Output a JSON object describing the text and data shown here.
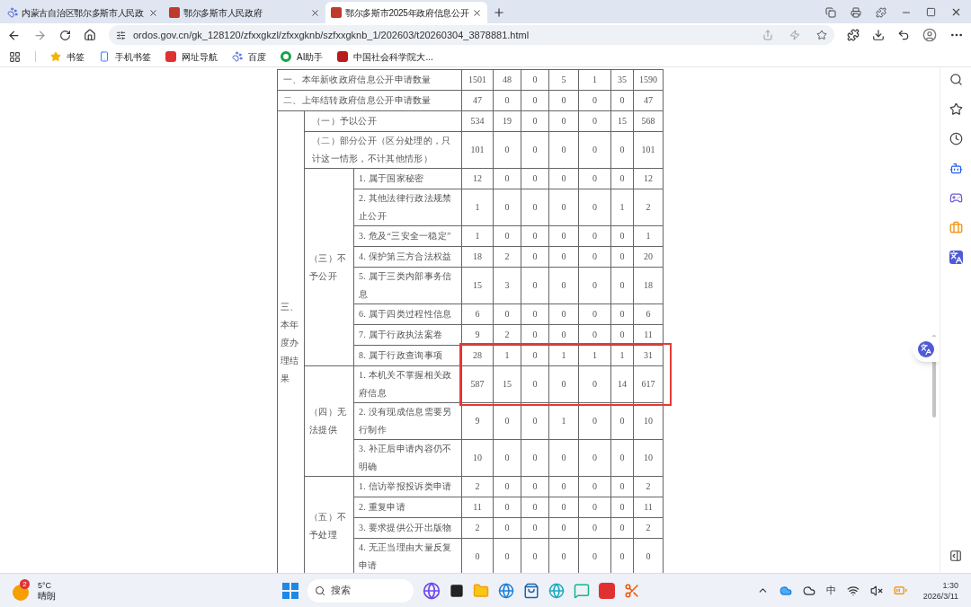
{
  "browser": {
    "tabs": [
      {
        "title": "内蒙古自治区鄂尔多斯市人民政",
        "selected": false
      },
      {
        "title": "鄂尔多斯市人民政府",
        "selected": false
      },
      {
        "title": "鄂尔多斯市2025年政府信息公开",
        "selected": true
      }
    ],
    "address": "ordos.gov.cn/gk_128120/zfxxgkzl/zfxxgknb/szfxxgknb_1/202603/t20260304_3878881.html",
    "bookmarks": [
      "书签",
      "手机书签",
      "网址导航",
      "百度",
      "AI助手",
      "中国社会科学院大..."
    ]
  },
  "table": {
    "top_rows": [
      {
        "label": "一、本年新收政府信息公开申请数量",
        "values": [
          "1501",
          "48",
          "0",
          "5",
          "1",
          "35",
          "1590"
        ]
      },
      {
        "label": "二、上年结转政府信息公开申请数量",
        "values": [
          "47",
          "0",
          "0",
          "0",
          "0",
          "0",
          "47"
        ]
      }
    ],
    "section": {
      "label": "三、本年度办理结果",
      "groups": [
        {
          "label": "（一）予以公开",
          "values": [
            "534",
            "19",
            "0",
            "0",
            "0",
            "15",
            "568"
          ]
        },
        {
          "label": "（二）部分公开（区分处理的，只计这一情形，不计其他情形）",
          "values": [
            "101",
            "0",
            "0",
            "0",
            "0",
            "0",
            "101"
          ]
        },
        {
          "label": "（三）不予公开",
          "items": [
            {
              "label": "1. 属于国家秘密",
              "values": [
                "12",
                "0",
                "0",
                "0",
                "0",
                "0",
                "12"
              ],
              "highlighted": false
            },
            {
              "label": "2. 其他法律行政法规禁止公开",
              "values": [
                "1",
                "0",
                "0",
                "0",
                "0",
                "1",
                "2"
              ],
              "highlighted": false
            },
            {
              "label": "3. 危及“三安全一稳定”",
              "values": [
                "1",
                "0",
                "0",
                "0",
                "0",
                "0",
                "1"
              ],
              "highlighted": false
            },
            {
              "label": "4. 保护第三方合法权益",
              "values": [
                "18",
                "2",
                "0",
                "0",
                "0",
                "0",
                "20"
              ],
              "highlighted": false
            },
            {
              "label": "5. 属于三类内部事务信息",
              "values": [
                "15",
                "3",
                "0",
                "0",
                "0",
                "0",
                "18"
              ],
              "highlighted": false
            },
            {
              "label": "6. 属于四类过程性信息",
              "values": [
                "6",
                "0",
                "0",
                "0",
                "0",
                "0",
                "6"
              ],
              "highlighted": false
            },
            {
              "label": "7. 属于行政执法案卷",
              "values": [
                "9",
                "2",
                "0",
                "0",
                "0",
                "0",
                "11"
              ],
              "highlighted": false
            },
            {
              "label": "8. 属于行政查询事项",
              "values": [
                "28",
                "1",
                "0",
                "1",
                "1",
                "1",
                "31"
              ],
              "highlighted": true
            }
          ]
        },
        {
          "label": "（四）无法提供",
          "items": [
            {
              "label": "1. 本机关不掌握相关政府信息",
              "values": [
                "587",
                "15",
                "0",
                "0",
                "0",
                "14",
                "617"
              ],
              "highlighted": true
            },
            {
              "label": "2. 没有现成信息需要另行制作",
              "values": [
                "9",
                "0",
                "0",
                "1",
                "0",
                "0",
                "10"
              ],
              "highlighted": false
            },
            {
              "label": "3. 补正后申请内容仍不明确",
              "values": [
                "10",
                "0",
                "0",
                "0",
                "0",
                "0",
                "10"
              ],
              "highlighted": false
            }
          ]
        },
        {
          "label": "（五）不予处理",
          "items": [
            {
              "label": "1. 信访举报投诉类申请",
              "values": [
                "2",
                "0",
                "0",
                "0",
                "0",
                "0",
                "2"
              ],
              "highlighted": false
            },
            {
              "label": "2. 重复申请",
              "values": [
                "11",
                "0",
                "0",
                "0",
                "0",
                "0",
                "11"
              ],
              "highlighted": false
            },
            {
              "label": "3. 要求提供公开出版物",
              "values": [
                "2",
                "0",
                "0",
                "0",
                "0",
                "0",
                "2"
              ],
              "highlighted": false
            },
            {
              "label": "4. 无正当理由大量反复申请",
              "values": [
                "0",
                "0",
                "0",
                "0",
                "0",
                "0",
                "0"
              ],
              "highlighted": false
            }
          ]
        }
      ]
    }
  },
  "taskbar": {
    "weather": {
      "badge": "2",
      "temperature": "5°C",
      "condition": "晴朗"
    },
    "search": {
      "placeholder": "搜索"
    },
    "ime": "中",
    "time": "1:30",
    "date": "2026/3/11"
  }
}
